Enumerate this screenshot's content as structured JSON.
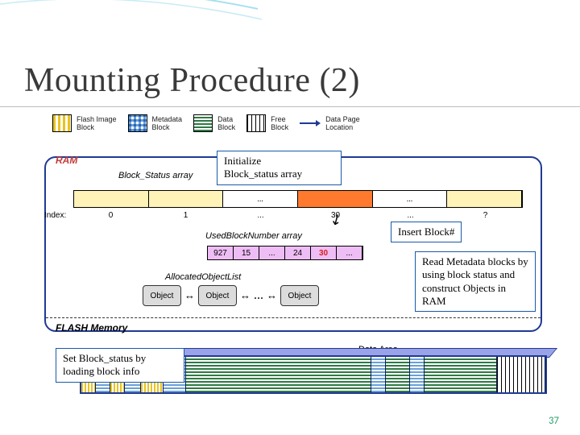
{
  "title": "Mounting Procedure (2)",
  "page_number": "37",
  "legend": {
    "flash_image": "Flash Image\nBlock",
    "metadata": "Metadata\nBlock",
    "data": "Data\nBlock",
    "free": "Free\nBlock",
    "data_page_loc": "Data Page\nLocation"
  },
  "ram": {
    "label": "RAM",
    "block_status_label": "Block_Status array",
    "index_label": "Index:",
    "indices": [
      "0",
      "1",
      "...",
      "30",
      "...",
      "?"
    ],
    "used_label": "UsedBlockNumber array",
    "used_values": [
      "927",
      "15",
      "...",
      "24",
      "30",
      "..."
    ],
    "alloc_label": "AllocatedObjectList",
    "object_label": "Object",
    "ellipsis": "..."
  },
  "flash": {
    "label": "FLASH Memory",
    "data_area": "Data Area"
  },
  "callouts": {
    "init": "Initialize\nBlock_status array",
    "insert": "Insert Block#",
    "read_meta": "Read Metadata blocks by using block status and construct Objects in RAM",
    "set_status": "Set Block_status by loading block info"
  }
}
